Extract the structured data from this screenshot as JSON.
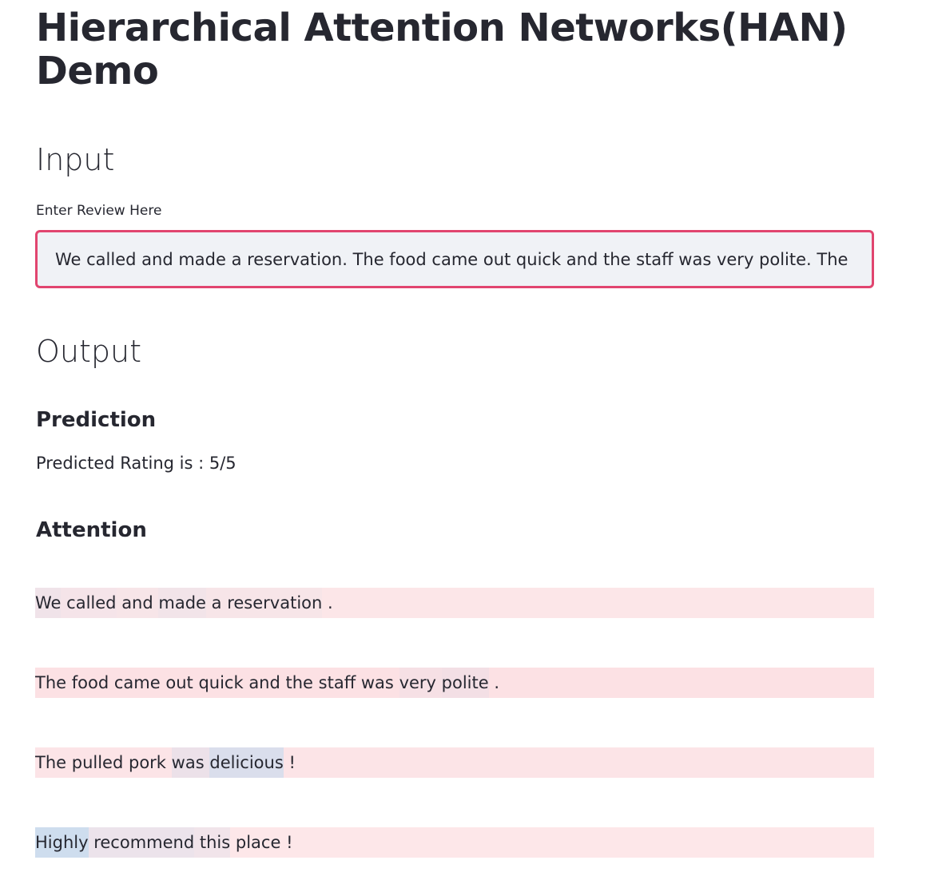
{
  "app": {
    "title": "Hierarchical Attention Networks(HAN) Demo"
  },
  "input_section": {
    "heading": "Input",
    "review_label": "Enter Review Here",
    "review_value": "We called and made a reservation. The food came out quick and the staff was very polite. The pulled pork was delicious! Highly recommend this place!"
  },
  "output_section": {
    "heading": "Output",
    "prediction_heading": "Prediction",
    "prediction_text": "Predicted Rating is : 5/5",
    "attention_heading": "Attention"
  },
  "attention": {
    "sentence_color": "#fce1e4",
    "word_color": "#c9dcee",
    "sentences": [
      {
        "weight": 0.18,
        "words": [
          {
            "text": "We",
            "weight": 0.25
          },
          {
            "text": "called",
            "weight": 0.15
          },
          {
            "text": "and",
            "weight": 0.1
          },
          {
            "text": "made",
            "weight": 0.2
          },
          {
            "text": "a",
            "weight": 0.1
          },
          {
            "text": "reservation",
            "weight": 0.1
          },
          {
            "text": ".",
            "weight": 0.0
          }
        ]
      },
      {
        "weight": 0.28,
        "words": [
          {
            "text": "The",
            "weight": 0.0
          },
          {
            "text": "food",
            "weight": 0.0
          },
          {
            "text": "came",
            "weight": 0.0
          },
          {
            "text": "out",
            "weight": 0.0
          },
          {
            "text": "quick",
            "weight": 0.0
          },
          {
            "text": "and",
            "weight": 0.0
          },
          {
            "text": "the",
            "weight": 0.0
          },
          {
            "text": "staff",
            "weight": 0.0
          },
          {
            "text": "was",
            "weight": 0.0
          },
          {
            "text": "very",
            "weight": 0.12
          },
          {
            "text": "polite",
            "weight": 0.18
          },
          {
            "text": ".",
            "weight": 0.0
          }
        ]
      },
      {
        "weight": 0.22,
        "words": [
          {
            "text": "The",
            "weight": 0.0
          },
          {
            "text": "pulled",
            "weight": 0.0
          },
          {
            "text": "pork",
            "weight": 0.0
          },
          {
            "text": "was",
            "weight": 0.35
          },
          {
            "text": "delicious",
            "weight": 0.75
          },
          {
            "text": "!",
            "weight": 0.0
          }
        ]
      },
      {
        "weight": 0.16,
        "words": [
          {
            "text": "Highly",
            "weight": 1.0
          },
          {
            "text": "recommend",
            "weight": 0.35
          },
          {
            "text": "this",
            "weight": 0.25
          },
          {
            "text": "place",
            "weight": 0.0
          },
          {
            "text": "!",
            "weight": 0.0
          }
        ]
      }
    ]
  }
}
